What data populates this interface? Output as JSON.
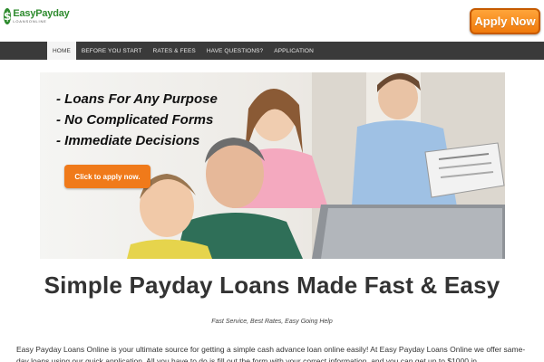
{
  "header": {
    "logo_icon": "dollar-icon",
    "logo_main": "EasyPayday",
    "logo_sub": "LOANSONLINE",
    "apply_button": "Apply Now"
  },
  "nav": {
    "items": [
      {
        "label": "HOME",
        "active": true
      },
      {
        "label": "BEFORE YOU START",
        "active": false
      },
      {
        "label": "RATES & FEES",
        "active": false
      },
      {
        "label": "HAVE QUESTIONS?",
        "active": false
      },
      {
        "label": "APPLICATION",
        "active": false
      }
    ]
  },
  "hero": {
    "bullets": [
      "- Loans For Any Purpose",
      "- No Complicated Forms",
      "- Immediate Decisions"
    ],
    "cta": "Click to apply now."
  },
  "main": {
    "title": "Simple Payday Loans Made Fast & Easy",
    "tagline": "Fast Service, Best Rates, Easy Going Help",
    "intro": "Easy Payday Loans Online is your ultimate source for getting a simple cash advance loan online easily! At Easy Payday Loans Online we offer same-day loans using our quick application. All you have to do is fill out the form with your correct information, and you can get up to $1000 in"
  },
  "colors": {
    "brand_green": "#2e8b2e",
    "accent_orange": "#f07a1a",
    "nav_bg": "#3a3a3a"
  }
}
